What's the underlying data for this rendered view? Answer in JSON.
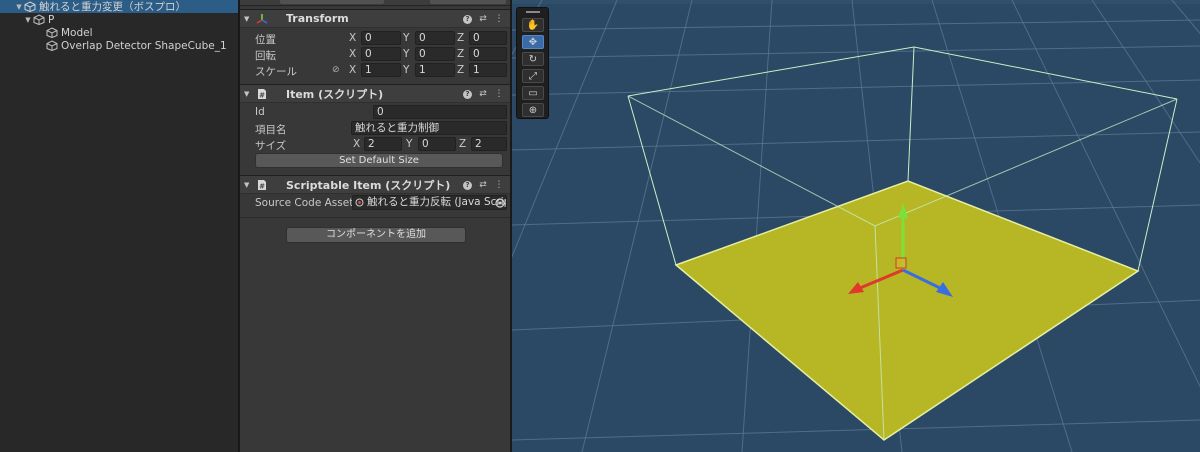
{
  "hierarchy": {
    "items": [
      {
        "label": "触れると重力変更（ボスプロ）",
        "selected": true
      },
      {
        "label": "P"
      },
      {
        "label": "Model"
      },
      {
        "label": "Overlap Detector ShapeCube_1"
      }
    ]
  },
  "inspector": {
    "transform": {
      "title": "Transform",
      "position": {
        "label": "位置",
        "x": "0",
        "y": "0",
        "z": "0"
      },
      "rotation": {
        "label": "回転",
        "x": "0",
        "y": "0",
        "z": "0"
      },
      "scale": {
        "label": "スケール",
        "x": "1",
        "y": "1",
        "z": "1"
      }
    },
    "item": {
      "title": "Item (スクリプト)",
      "id": {
        "label": "Id",
        "value": "0"
      },
      "name": {
        "label": "項目名",
        "value": "触れると重力制御"
      },
      "size": {
        "label": "サイズ",
        "x": "2",
        "y": "0",
        "z": "2"
      },
      "button": "Set Default Size"
    },
    "scriptable": {
      "title": "Scriptable Item (スクリプト)",
      "source": {
        "label": "Source Code Asset",
        "value": "触れると重力反転 (Java Script"
      }
    },
    "add_component": "コンポーネントを追加",
    "axis_labels": {
      "x": "X",
      "y": "Y",
      "z": "Z"
    },
    "header_icons": {
      "help": "?",
      "presets": "⇄",
      "menu": "⋮"
    }
  },
  "scene": {
    "tools": [
      "hand-tool",
      "move-tool",
      "rotate-tool",
      "scale-tool",
      "rect-tool",
      "transform-tool"
    ],
    "active_tool": "move-tool",
    "colors": {
      "background": "#2b4864",
      "plane": "#b7b726",
      "bounds": "#c8f0c8",
      "x_axis": "#e0382a",
      "y_axis": "#7ce03a",
      "z_axis": "#3a6ee0"
    }
  }
}
